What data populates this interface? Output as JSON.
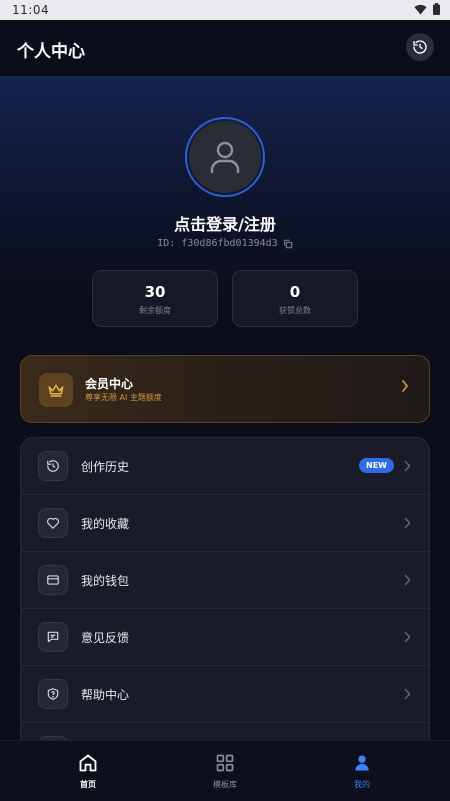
{
  "status_bar": {
    "time": "11:04"
  },
  "header": {
    "title": "个人中心"
  },
  "profile": {
    "login_text": "点击登录/注册",
    "id_label": "ID: f30d86fbd01394d3"
  },
  "stats": [
    {
      "value": "30",
      "label": "剩余额度"
    },
    {
      "value": "0",
      "label": "获赞总数"
    }
  ],
  "vip": {
    "title": "会员中心",
    "subtitle": "尊享无限 AI 主题额度"
  },
  "menu": [
    {
      "label": "创作历史",
      "icon": "history-icon",
      "badge": "NEW"
    },
    {
      "label": "我的收藏",
      "icon": "heart-icon"
    },
    {
      "label": "我的钱包",
      "icon": "wallet-icon"
    },
    {
      "label": "意见反馈",
      "icon": "feedback-icon"
    },
    {
      "label": "帮助中心",
      "icon": "help-icon"
    }
  ],
  "bottom_nav": [
    {
      "label": "首页",
      "icon": "home-icon"
    },
    {
      "label": "模板库",
      "icon": "grid-icon"
    },
    {
      "label": "我的",
      "icon": "user-icon",
      "active": true
    }
  ],
  "colors": {
    "accent": "#2f6ae8",
    "active_nav": "#3b82f6",
    "gold": "#d09a3d",
    "background": "#0b0d1a"
  }
}
